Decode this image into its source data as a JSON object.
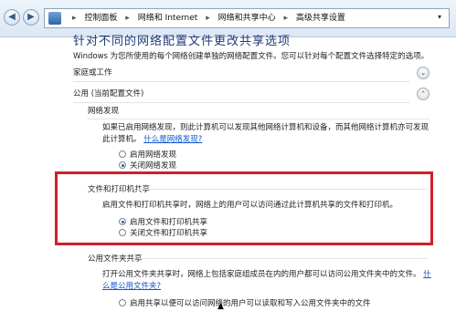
{
  "addressbar": {
    "back_glyph": "◀",
    "forward_glyph": "▶",
    "breadcrumbs": [
      "控制面板",
      "网络和 Internet",
      "网络和共享中心",
      "高级共享设置"
    ],
    "separator": "▸",
    "dropdown_glyph": "▾"
  },
  "page": {
    "title": "针对不同的网络配置文件更改共享选项",
    "intro": "Windows 为您所使用的每个网络创建单独的网络配置文件。您可以针对每个配置文件选择特定的选项。"
  },
  "profiles": {
    "home": {
      "label": "家庭或工作",
      "chevron": "⌄"
    },
    "public": {
      "label": "公用 (当前配置文件)",
      "chevron": "⌃"
    }
  },
  "network_discovery": {
    "heading": "网络发现",
    "description": "如果已启用网络发现，则此计算机可以发现其他网络计算机和设备，而其他网络计算机亦可发现此计算机。",
    "link": "什么是网络发现?",
    "options": [
      "启用网络发现",
      "关闭网络发现"
    ],
    "selected_index": 1
  },
  "file_printer_sharing": {
    "heading": "文件和打印机共享",
    "description": "启用文件和打印机共享时，网络上的用户可以访问通过此计算机共享的文件和打印机。",
    "options": [
      "启用文件和打印机共享",
      "关闭文件和打印机共享"
    ],
    "selected_index": 0
  },
  "public_folder_sharing": {
    "heading": "公用文件夹共享",
    "description": "打开公用文件夹共享时，网络上包括家庭组成员在内的用户都可以访问公用文件夹中的文件。",
    "link": "什么是公用文件夹?",
    "partial_option": "启用共享以便可以访问网络的用户可以读取和写入公用文件夹中的文件"
  },
  "highlight_color": "#d01f2a"
}
